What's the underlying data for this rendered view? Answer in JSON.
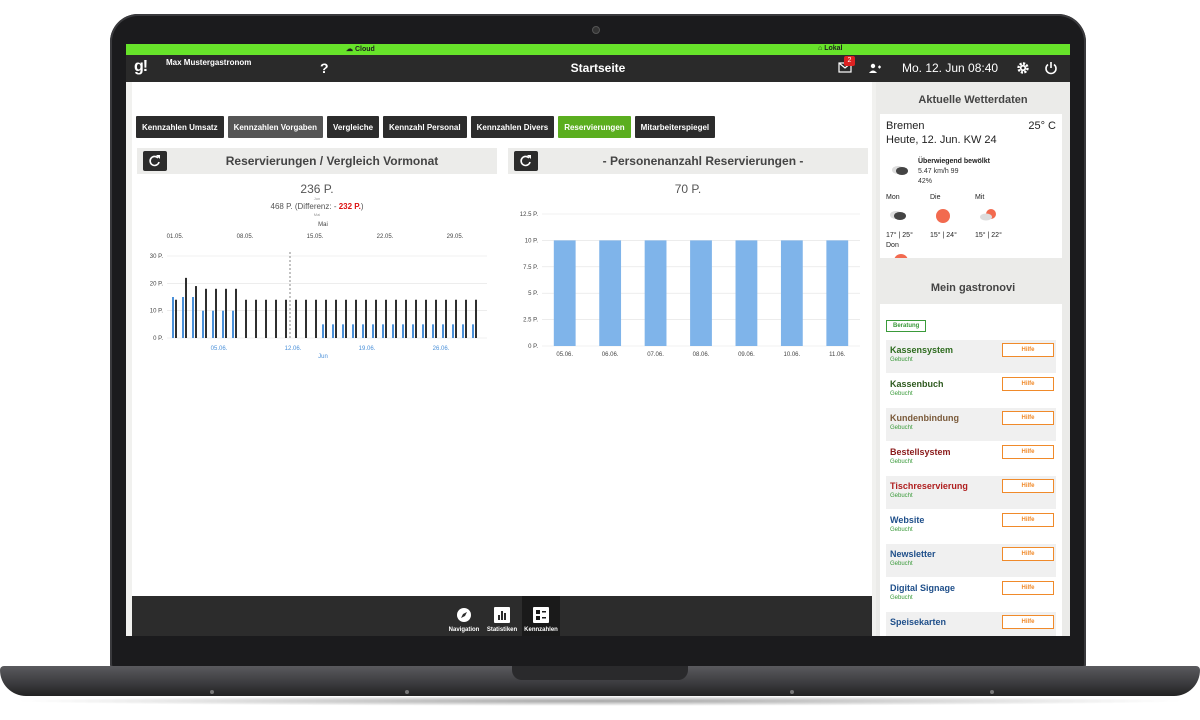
{
  "connection": {
    "cloud_label": "Cloud",
    "local_label": "Lokal"
  },
  "header": {
    "logo": "g!",
    "user_name": "Max Mustergastronom",
    "help": "?",
    "title": "Startseite",
    "mail_badge": "2",
    "datetime": "Mo. 12. Jun 08:40"
  },
  "tabs": [
    {
      "label": "Kennzahlen Umsatz",
      "state": "normal"
    },
    {
      "label": "Kennzahlen Vorgaben",
      "state": "muted"
    },
    {
      "label": "Vergleiche",
      "state": "normal"
    },
    {
      "label": "Kennzahl Personal",
      "state": "normal"
    },
    {
      "label": "Kennzahlen Divers",
      "state": "normal"
    },
    {
      "label": "Reservierungen",
      "state": "active"
    },
    {
      "label": "Mitarbeiterspiegel",
      "state": "normal"
    }
  ],
  "panel_left": {
    "title": "Reservierungen / Vergleich Vormonat",
    "current_total": "236 P.",
    "current_period": "Jun",
    "previous_total": "468 P.",
    "diff_prefix": "(Differenz: -",
    "diff_value": "232 P.",
    "diff_suffix": ")",
    "previous_period": "Mai"
  },
  "panel_right": {
    "title": "- Personenanzahl Reservierungen -",
    "total": "70 P."
  },
  "chart_data": [
    {
      "type": "bar",
      "title": "Reservierungen / Vergleich Vormonat",
      "top_axis_label": "Mai",
      "top_ticks": [
        "01.05.",
        "08.05.",
        "15.05.",
        "22.05.",
        "29.05."
      ],
      "bottom_axis_label": "Jun",
      "bottom_ticks": [
        "05.06.",
        "12.06.",
        "19.06.",
        "26.06."
      ],
      "y_ticks": [
        "0 P.",
        "10 P.",
        "20 P.",
        "30 P."
      ],
      "ylim": [
        0,
        30
      ],
      "series": [
        {
          "name": "Mai",
          "color": "#2f2f2f",
          "values": [
            14,
            22,
            19,
            18,
            18,
            18,
            18,
            14,
            14,
            14,
            14,
            14,
            14,
            14,
            14,
            14,
            14,
            14,
            14,
            14,
            14,
            14,
            14,
            14,
            14,
            14,
            14,
            14,
            14,
            14,
            14
          ]
        },
        {
          "name": "Jun",
          "color": "#4a90d9",
          "values": [
            15,
            15,
            15,
            10,
            10,
            10,
            10,
            0,
            0,
            0,
            0,
            0,
            0,
            0,
            0,
            5,
            5,
            5,
            5,
            5,
            5,
            5,
            5,
            5,
            5,
            5,
            5,
            5,
            5,
            5,
            5
          ]
        }
      ]
    },
    {
      "type": "bar",
      "title": "- Personenanzahl Reservierungen -",
      "categories": [
        "05.06.",
        "06.06.",
        "07.06.",
        "08.06.",
        "09.06.",
        "10.06.",
        "11.06."
      ],
      "values": [
        10,
        10,
        10,
        10,
        10,
        10,
        10
      ],
      "y_ticks": [
        "0 P.",
        "2.5 P.",
        "5 P.",
        "7.5 P.",
        "10 P.",
        "12.5 P."
      ],
      "ylim": [
        0,
        12.5
      ],
      "color": "#7fb4ea"
    }
  ],
  "bottom_nav": [
    {
      "label": "Navigation",
      "icon": "compass-icon"
    },
    {
      "label": "Statistiken",
      "icon": "bar-chart-icon"
    },
    {
      "label": "Kennzahlen",
      "icon": "dashboard-icon",
      "active": true
    }
  ],
  "weather": {
    "title": "Aktuelle Wetterdaten",
    "city": "Bremen",
    "temperature": "25° C",
    "date_line": "Heute, 12. Jun. KW 24",
    "condition": "Überwiegend bewölkt",
    "wind": "5.47 km/h 99",
    "humidity": "42%",
    "forecast": [
      {
        "day": "Mon",
        "range": "17° | 25°",
        "icon": "cloud-icon"
      },
      {
        "day": "Die",
        "range": "15° | 24°",
        "icon": "sun-icon"
      },
      {
        "day": "Mit",
        "range": "15° | 22°",
        "icon": "sun-cloud-icon"
      },
      {
        "day": "Don",
        "range": "",
        "icon": "sun-icon"
      }
    ]
  },
  "gastronovi": {
    "title": "Mein gastronovi",
    "beratung": "Beratung",
    "help_label": "Hilfe",
    "items": [
      {
        "name": "Kassensystem",
        "status": "Gebucht",
        "color": "#2e6b1f"
      },
      {
        "name": "Kassenbuch",
        "status": "Gebucht",
        "color": "#2e5a1f"
      },
      {
        "name": "Kundenbindung",
        "status": "Gebucht",
        "color": "#7a5a3a"
      },
      {
        "name": "Bestellsystem",
        "status": "Gebucht",
        "color": "#8a1a1a"
      },
      {
        "name": "Tischreservierung",
        "status": "Gebucht",
        "color": "#b02020"
      },
      {
        "name": "Website",
        "status": "Gebucht",
        "color": "#1f4f8a"
      },
      {
        "name": "Newsletter",
        "status": "Gebucht",
        "color": "#1f4f8a"
      },
      {
        "name": "Digital Signage",
        "status": "Gebucht",
        "color": "#1f4f8a"
      },
      {
        "name": "Speisekarten",
        "status": "",
        "color": "#1f4f8a"
      }
    ]
  }
}
